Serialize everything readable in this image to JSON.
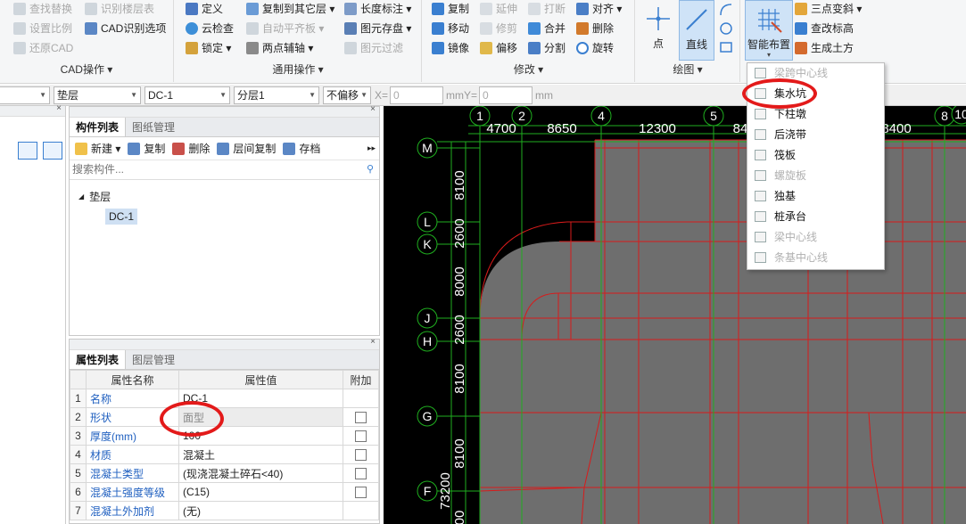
{
  "ribbon": {
    "cad_group": {
      "title": "CAD操作 ▾",
      "items": [
        {
          "label": "查找替换",
          "enabled": false
        },
        {
          "label": "识别楼层表",
          "enabled": false
        },
        {
          "label": "设置比例",
          "enabled": false
        },
        {
          "label": "CAD识别选项",
          "enabled": true
        },
        {
          "label": "还原CAD",
          "enabled": false
        }
      ]
    },
    "common_group": {
      "title": "通用操作 ▾",
      "items": [
        {
          "label": "定义",
          "enabled": true
        },
        {
          "label": "复制到其它层 ▾",
          "enabled": true
        },
        {
          "label": "长度标注 ▾",
          "enabled": true
        },
        {
          "label": "云检查",
          "enabled": true
        },
        {
          "label": "自动平齐板 ▾",
          "enabled": false
        },
        {
          "label": "图元存盘 ▾",
          "enabled": true
        },
        {
          "label": "锁定 ▾",
          "enabled": true
        },
        {
          "label": "两点辅轴 ▾",
          "enabled": true
        },
        {
          "label": "图元过滤",
          "enabled": false
        }
      ]
    },
    "modify_group": {
      "title": "修改 ▾",
      "items": [
        {
          "label": "复制",
          "enabled": true
        },
        {
          "label": "延伸",
          "enabled": false
        },
        {
          "label": "打断",
          "enabled": false
        },
        {
          "label": "对齐 ▾",
          "enabled": true
        },
        {
          "label": "移动",
          "enabled": true
        },
        {
          "label": "修剪",
          "enabled": false
        },
        {
          "label": "合并",
          "enabled": true
        },
        {
          "label": "删除",
          "enabled": true
        },
        {
          "label": "镜像",
          "enabled": true
        },
        {
          "label": "偏移",
          "enabled": true
        },
        {
          "label": "分割",
          "enabled": true
        },
        {
          "label": "旋转",
          "enabled": true
        }
      ]
    },
    "draw_group": {
      "title": "绘图 ▾",
      "point_label": "点",
      "line_label": "直线"
    },
    "smart_group": {
      "smart_label": "智能布置",
      "items": [
        {
          "label": "三点变斜 ▾",
          "enabled": true
        },
        {
          "label": "查改标高",
          "enabled": true
        },
        {
          "label": "生成土方",
          "enabled": true
        }
      ]
    }
  },
  "propbar": {
    "layer": "垫层",
    "component": "DC-1",
    "sublayer": "分层1",
    "offset": "不偏移",
    "x_label": "X=",
    "x_value": "0",
    "y_label": "mmY=",
    "y_value": "0",
    "unit": "mm"
  },
  "component_panel": {
    "tabs": [
      "构件列表",
      "图纸管理"
    ],
    "toolbar": [
      "新建 ▾",
      "复制",
      "删除",
      "层间复制",
      "存档"
    ],
    "search_placeholder": "搜索构件...",
    "tree_root": "垫层",
    "tree_child": "DC-1"
  },
  "property_panel": {
    "tabs": [
      "属性列表",
      "图层管理"
    ],
    "headers": [
      "属性名称",
      "属性值",
      "附加"
    ],
    "rows": [
      {
        "n": "1",
        "name": "名称",
        "value": "DC-1",
        "checkbox": false
      },
      {
        "n": "2",
        "name": "形状",
        "value": "面型",
        "checkbox": true
      },
      {
        "n": "3",
        "name": "厚度(mm)",
        "value": "100",
        "checkbox": true
      },
      {
        "n": "4",
        "name": "材质",
        "value": "混凝土",
        "checkbox": true
      },
      {
        "n": "5",
        "name": "混凝土类型",
        "value": "(现浇混凝土碎石<40)",
        "checkbox": true
      },
      {
        "n": "6",
        "name": "混凝土强度等级",
        "value": "(C15)",
        "checkbox": true
      },
      {
        "n": "7",
        "name": "混凝土外加剂",
        "value": "(无)",
        "checkbox": false
      }
    ]
  },
  "canvas": {
    "top_axes": [
      "1",
      "2",
      "4",
      "5",
      "8"
    ],
    "top_axis_extra": "10",
    "top_dims": [
      "4700",
      "8650",
      "12300",
      "84",
      "8400"
    ],
    "left_axes": [
      "M",
      "L",
      "K",
      "J",
      "H",
      "G",
      "F"
    ],
    "left_dims": [
      "8100",
      "2600",
      "8000",
      "2600",
      "8100",
      "8100"
    ],
    "left_bottom_dim": "73200",
    "left_cut_dim": "00",
    "colors": {
      "grid": "#1fae1f",
      "beam": "#d81b1b",
      "slab": "#6e6e6e"
    }
  },
  "dropdown": {
    "items": [
      {
        "label": "梁跨中心线",
        "enabled": false
      },
      {
        "label": "集水坑",
        "enabled": true
      },
      {
        "label": "下柱墩",
        "enabled": true
      },
      {
        "label": "后浇带",
        "enabled": true
      },
      {
        "label": "筏板",
        "enabled": true
      },
      {
        "label": "螺旋板",
        "enabled": false
      },
      {
        "label": "独基",
        "enabled": true
      },
      {
        "label": "桩承台",
        "enabled": true
      },
      {
        "label": "梁中心线",
        "enabled": false
      },
      {
        "label": "条基中心线",
        "enabled": false
      }
    ]
  }
}
